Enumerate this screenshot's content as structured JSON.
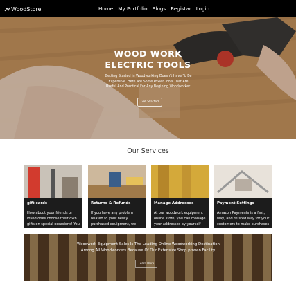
{
  "brand": {
    "logo": "WoodStore"
  },
  "nav": {
    "items": [
      "Home",
      "My Portfolio",
      "Blogs",
      "Registar",
      "Login"
    ]
  },
  "hero": {
    "title_line1": "WOOD WORK",
    "title_line2": "ELECTRIC TOOLS",
    "text": "Getting Started In Woodworking Doesn't Have To Be Expensive. Here Are Some Power Tools That Are Useful And Practical For Any Begining Woodworker.",
    "button": "Get Started"
  },
  "services": {
    "title": "Our Services",
    "cards": [
      {
        "title": "gift cards",
        "text": "How about your friends or loved ones choose their own gifts on special occasions! You can now"
      },
      {
        "title": "Returns & Refunds",
        "text": "If you have any problem related to your newly purchased equipment, we have return"
      },
      {
        "title": "Manage Addresses",
        "text": "At our woodwork equipment online store, you can manage your addresses by yourself with"
      },
      {
        "title": "Payment Settings",
        "text": "Amazon Payments is a fast, way, and trusted way for your customers to make purchases on"
      }
    ]
  },
  "band": {
    "text": "Woodwork Equipment Sales Is The Leading Online Woodworking Destination Among All Woodworkers Because Of Our Extensive Shop proven Facility.",
    "button": "Learn More"
  }
}
